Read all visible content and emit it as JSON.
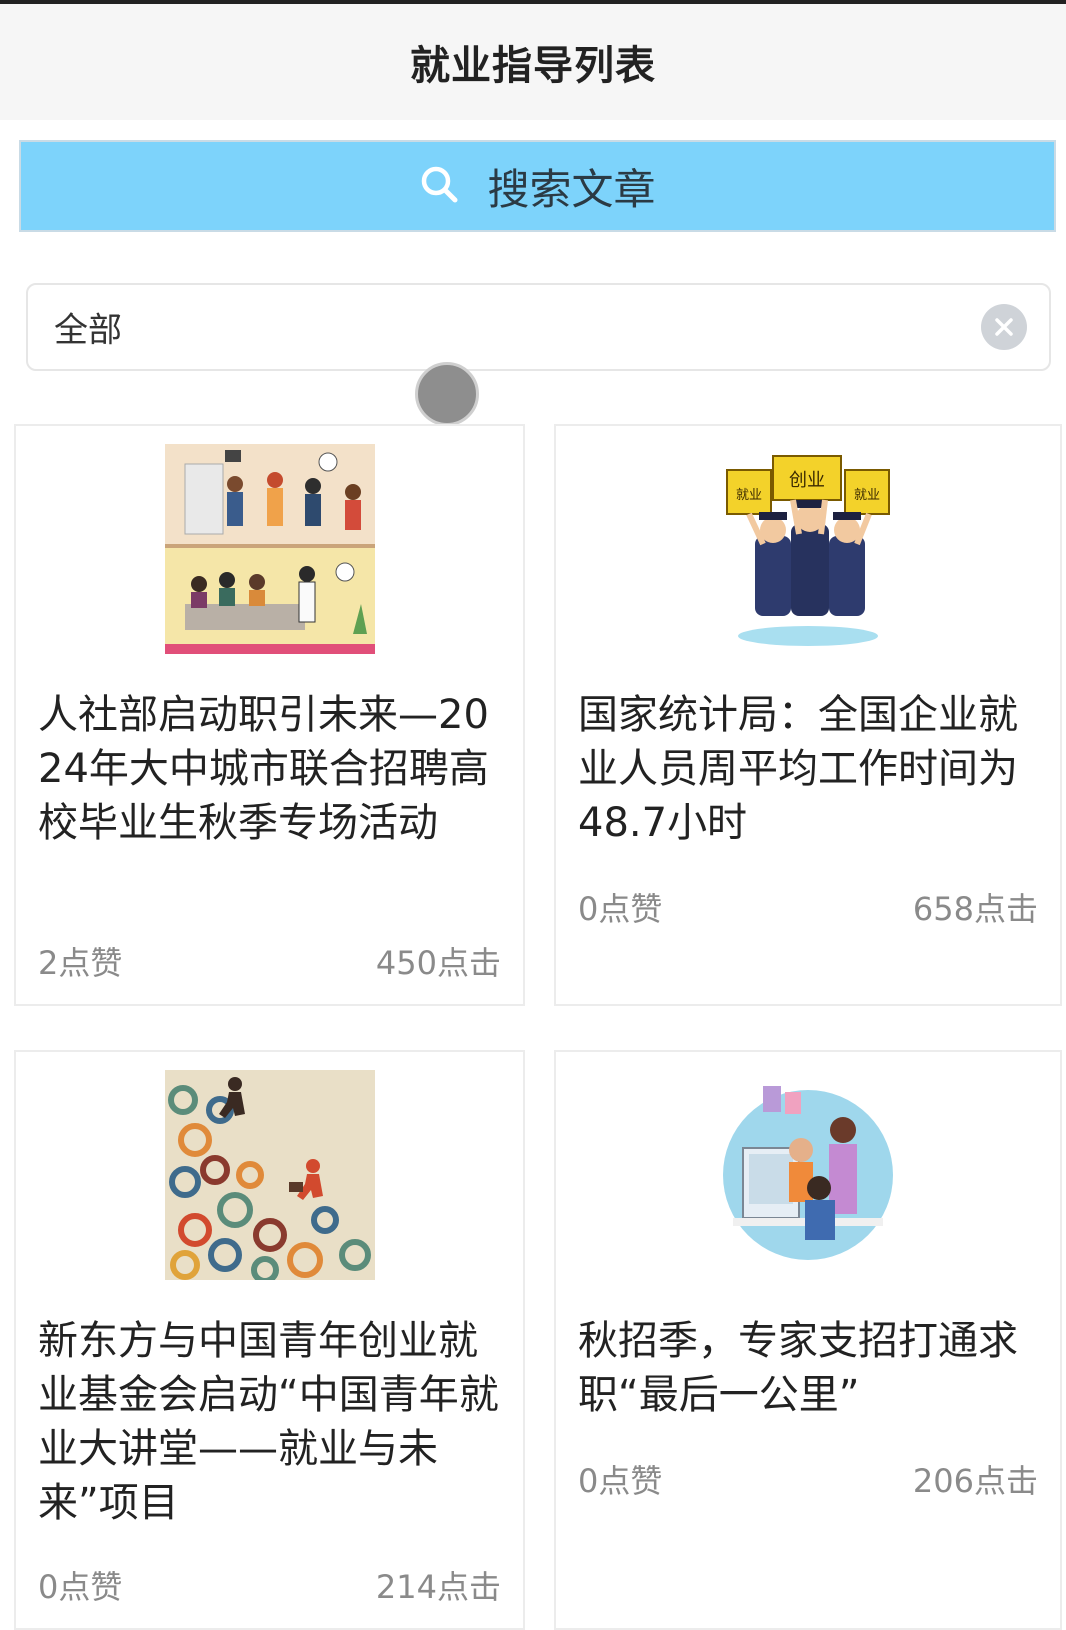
{
  "header": {
    "title": "就业指导列表"
  },
  "search": {
    "label": "搜索文章",
    "icon": "search-icon",
    "bg": "#7dd3fb"
  },
  "filter": {
    "value": "全部",
    "clear_icon": "clear-icon"
  },
  "articles": [
    {
      "title": "人社部启动职引未来—2024年大中城市联合招聘高校毕业生秋季专场活动",
      "likes": "2点赞",
      "clicks": "450点击",
      "image": "office-meeting-illustration"
    },
    {
      "title": "国家统计局：全国企业就业人员周平均工作时间为48.7小时",
      "likes": "0点赞",
      "clicks": "658点击",
      "image": "graduates-holding-signs-illustration",
      "sign_texts": [
        "就业",
        "创业",
        "就业"
      ]
    },
    {
      "title": "新东方与中国青年创业就业基金会启动“中国青年就业大讲堂——就业与未来”项目",
      "likes": "0点赞",
      "clicks": "214点击",
      "image": "gears-runners-illustration"
    },
    {
      "title": "秋招季，专家支招打通求职“最后一公里”",
      "likes": "0点赞",
      "clicks": "206点击",
      "image": "people-at-computer-illustration"
    }
  ]
}
